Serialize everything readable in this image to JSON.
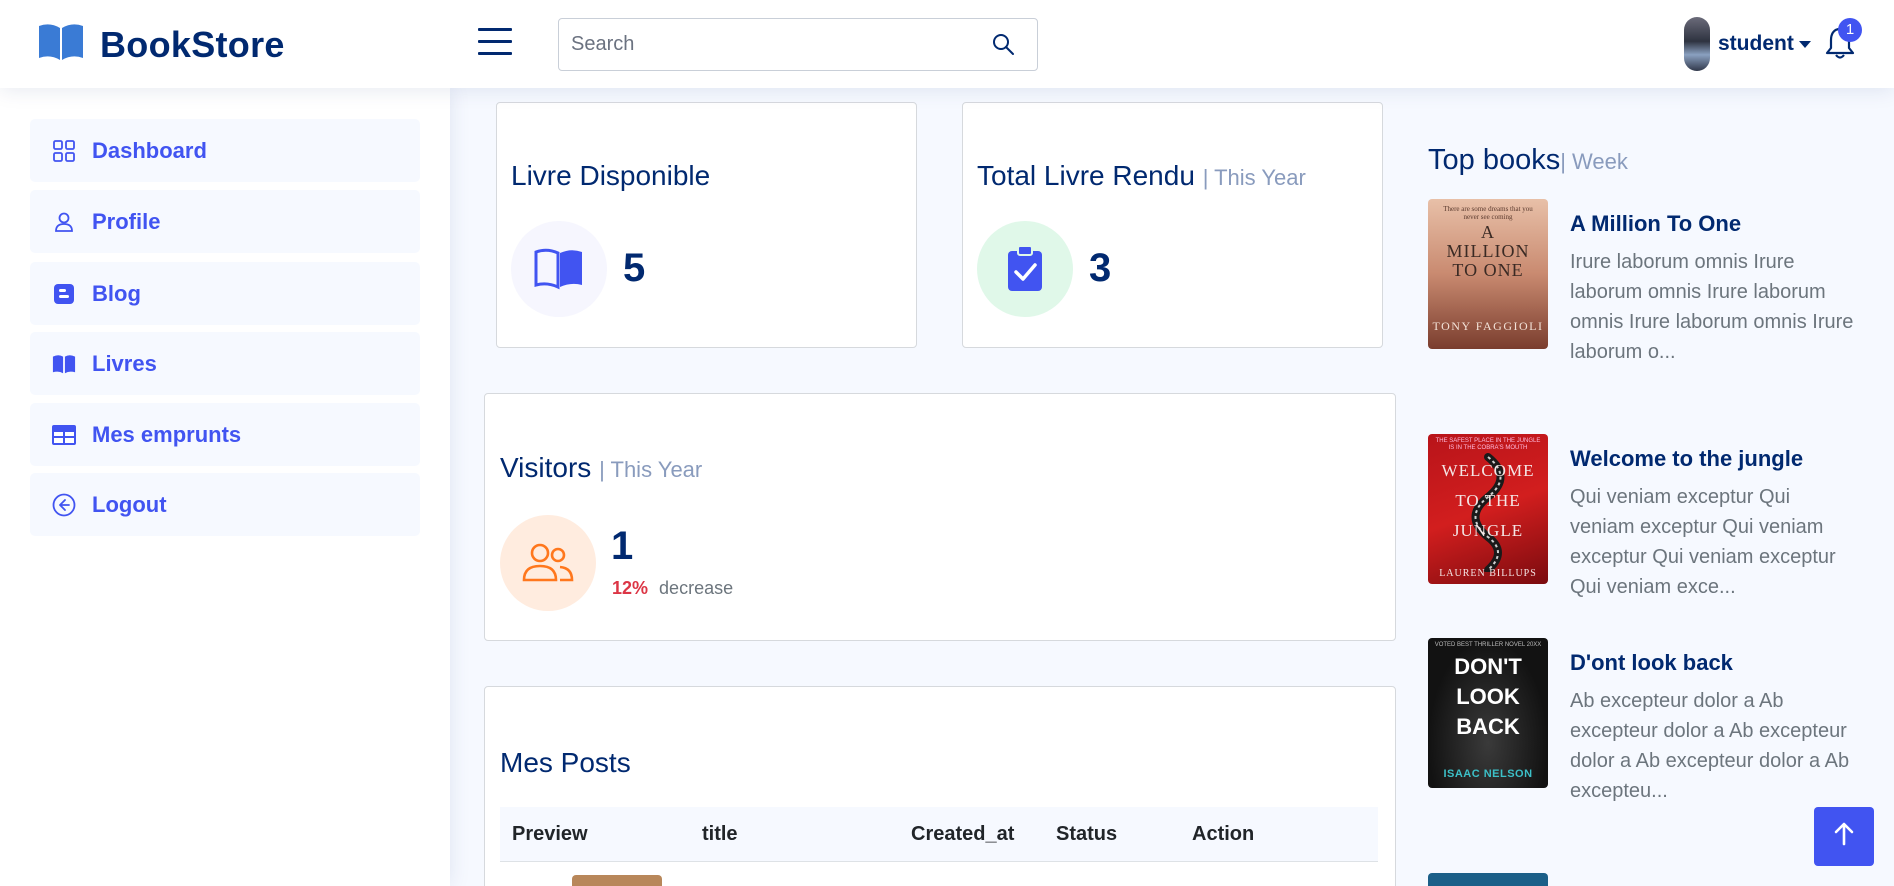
{
  "app": {
    "name": "BookStore"
  },
  "search": {
    "placeholder": "Search"
  },
  "user": {
    "name": "student",
    "notifications": "1"
  },
  "sidebar": {
    "items": [
      {
        "label": "Dashboard",
        "icon": "grid-icon"
      },
      {
        "label": "Profile",
        "icon": "person-icon"
      },
      {
        "label": "Blog",
        "icon": "blogger-icon"
      },
      {
        "label": "Livres",
        "icon": "book-icon"
      },
      {
        "label": "Mes emprunts",
        "icon": "table-icon"
      },
      {
        "label": "Logout",
        "icon": "arrow-left-circle-icon"
      }
    ]
  },
  "cards": {
    "available": {
      "title": "Livre Disponible",
      "value": "5"
    },
    "returned": {
      "title": "Total Livre Rendu",
      "period": "| This Year",
      "value": "3"
    },
    "visitors": {
      "title": "Visitors",
      "period": "| This Year",
      "value": "1",
      "change": "12%",
      "change_label": "decrease"
    }
  },
  "posts": {
    "title": "Mes Posts",
    "columns": [
      "Preview",
      "title",
      "Created_at",
      "Status",
      "Action"
    ]
  },
  "top_books": {
    "title": "Top books",
    "period": "| Week",
    "items": [
      {
        "title": "A Million To One",
        "excerpt": "Irure laborum omnis Irure laborum omnis Irure laborum omnis Irure laborum omnis Irure laborum o...",
        "cover": {
          "line1": "A",
          "line2": "MILLION",
          "line3": "TO ONE",
          "author": "TONY FAGGIOLI",
          "tagline": "There are some dreams that you never see coming"
        }
      },
      {
        "title": "Welcome to the jungle",
        "excerpt": "Qui veniam exceptur Qui veniam exceptur Qui veniam exceptur Qui veniam exceptur Qui veniam exce...",
        "cover": {
          "line1": "WELCOME",
          "line2": "TO THE",
          "line3": "JUNGLE",
          "author": "LAUREN BILLUPS",
          "tagline": "THE SAFEST PLACE IN THE JUNGLE IS IN THE COBRA'S MOUTH"
        }
      },
      {
        "title": "D'ont look back",
        "excerpt": "Ab excepteur dolor a Ab excepteur dolor a Ab excepteur dolor a Ab excepteur dolor a Ab excepteu...",
        "cover": {
          "line1": "DON'T",
          "line2": "LOOK",
          "line3": "BACK",
          "author": "ISAAC NELSON",
          "tagline": "VOTED BEST THRILLER NOVEL 20XX"
        }
      }
    ]
  },
  "colors": {
    "primary": "#4154f1",
    "navy": "#012970",
    "muted": "#899bbd",
    "danger": "#dc3545",
    "orange": "#ff771d"
  }
}
